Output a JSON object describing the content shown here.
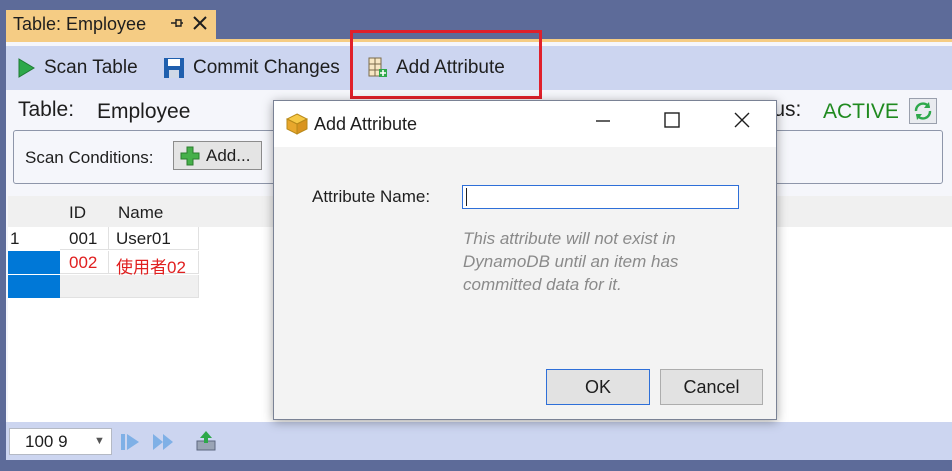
{
  "tab": {
    "title": "Table: Employee",
    "pin_icon": "pin-icon",
    "close_icon": "close-icon"
  },
  "toolbar": {
    "scan_label": "Scan Table",
    "commit_label": "Commit Changes",
    "add_attr_label": "Add Attribute"
  },
  "table": {
    "label": "Table:",
    "name": "Employee"
  },
  "status": {
    "label": "Status:",
    "value": "ACTIVE"
  },
  "scan": {
    "label": "Scan Conditions:",
    "add_label": "Add..."
  },
  "grid": {
    "headers": [
      "ID",
      "Name"
    ],
    "rows": [
      {
        "num": "1",
        "id": "001",
        "name": "User01"
      },
      {
        "num": "",
        "id": "002",
        "name": "使用者02"
      }
    ]
  },
  "pager": {
    "page_size": "100 9"
  },
  "dialog": {
    "title": "Add Attribute",
    "attr_label": "Attribute Name:",
    "attr_value": "",
    "note": "This attribute will not exist in DynamoDB until an item has committed data for it.",
    "ok_label": "OK",
    "cancel_label": "Cancel"
  },
  "colors": {
    "accent_tab": "#f5cc84",
    "toolbar": "#ccd5f0",
    "highlight_box": "#e0202b",
    "status_active": "#1f8a1f",
    "modified_row": "#e02020",
    "row_selector": "#0078d7"
  }
}
